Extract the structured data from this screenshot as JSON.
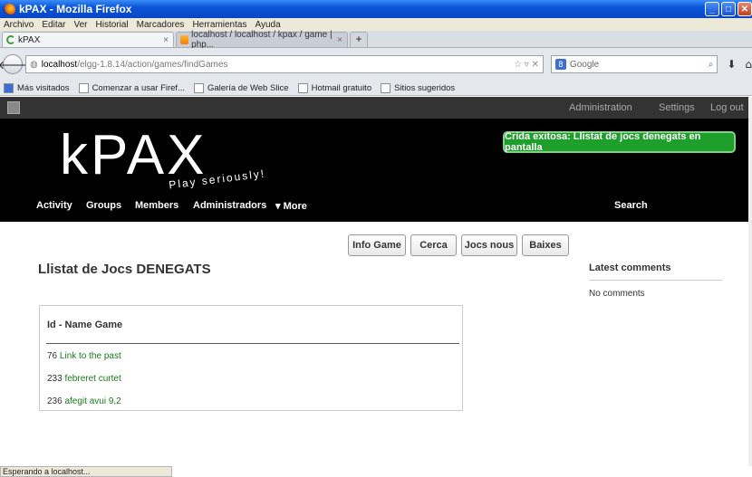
{
  "window": {
    "title": "kPAX - Mozilla Firefox"
  },
  "menu": [
    "Archivo",
    "Editar",
    "Ver",
    "Historial",
    "Marcadores",
    "Herramientas",
    "Ayuda"
  ],
  "tabs": [
    {
      "label": "kPAX"
    },
    {
      "label": "localhost / localhost / kpax / game | php..."
    }
  ],
  "nav": {
    "url_host": "localhost",
    "url_path": "/elgg-1.8.14/action/games/findGames",
    "search_placeholder": "Google"
  },
  "bookmarks": [
    "Más visitados",
    "Comenzar a usar Firef...",
    "Galería de Web Slice",
    "Hotmail gratuito",
    "Sitios sugeridos"
  ],
  "topbar": {
    "administration": "Administration",
    "settings": "Settings",
    "logout": "Log out"
  },
  "header": {
    "logo": "kPAX",
    "tagline": "Play seriously!",
    "flash": "Crida exitosa: Llistat de jocs denegats en pantalla"
  },
  "mainnav": {
    "activity": "Activity",
    "groups": "Groups",
    "members": "Members",
    "admins": "Administradors",
    "more": "▾ More",
    "search": "Search"
  },
  "buttons": {
    "info": "Info Game",
    "cerca": "Cerca",
    "nous": "Jocs nous",
    "baixes": "Baixes"
  },
  "page": {
    "title": "Llistat de Jocs DENEGATS",
    "list_header": "Id - Name Game",
    "games": [
      {
        "id": "76",
        "name": "Link to the past"
      },
      {
        "id": "233",
        "name": "febreret curtet"
      },
      {
        "id": "236",
        "name": "afegit avui 9,2"
      }
    ]
  },
  "sidebar": {
    "title": "Latest comments",
    "empty": "No comments"
  },
  "status": "Esperando a localhost..."
}
